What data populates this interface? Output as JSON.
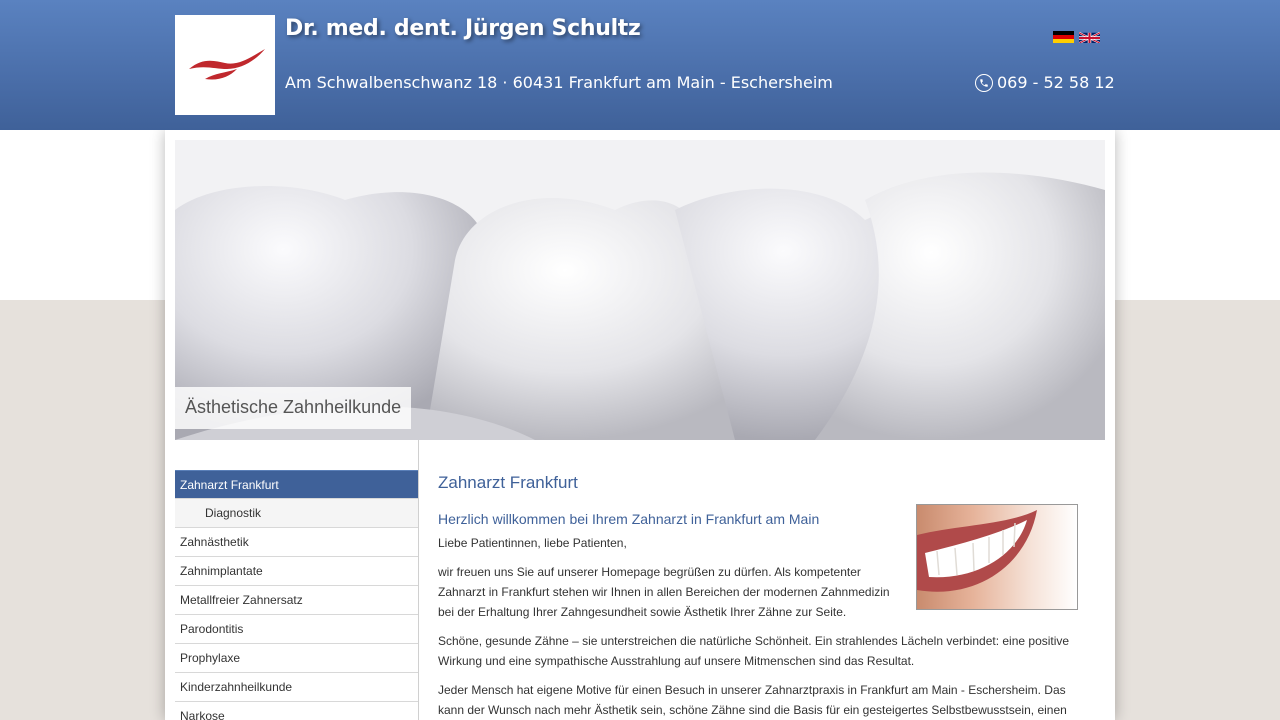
{
  "header": {
    "title": "Dr. med. dent. Jürgen Schultz",
    "address": "Am Schwalbenschwanz 18 · 60431 Frankfurt am Main - Eschersheim",
    "phone": "069 - 52 58 12",
    "languages": [
      "Deutsch",
      "English"
    ]
  },
  "hero": {
    "caption": "Ästhetische Zahnheilkunde"
  },
  "sidebar": {
    "items": [
      {
        "label": "Zahnarzt Frankfurt",
        "active": true
      },
      {
        "label": "Diagnostik",
        "sub": true
      },
      {
        "label": "Zahnästhetik"
      },
      {
        "label": "Zahnimplantate"
      },
      {
        "label": "Metallfreier Zahnersatz"
      },
      {
        "label": "Parodontitis"
      },
      {
        "label": "Prophylaxe"
      },
      {
        "label": "Kinderzahnheilkunde"
      },
      {
        "label": "Narkose"
      }
    ]
  },
  "content": {
    "heading": "Zahnarzt Frankfurt",
    "subheading": "Herzlich willkommen bei Ihrem Zahnarzt in Frankfurt am Main",
    "greeting": "Liebe Patientinnen, liebe Patienten,",
    "paragraph1": "wir freuen uns Sie auf unserer Homepage begrüßen zu dürfen. Als kompetenter Zahnarzt in Frankfurt stehen wir Ihnen in allen Bereichen der modernen Zahnmedizin bei der Erhaltung Ihrer Zahngesundheit sowie Ästhetik Ihrer Zähne zur Seite.",
    "paragraph2": "Schöne, gesunde Zähne – sie unterstreichen die natürliche Schönheit. Ein strahlendes Lächeln verbindet: eine positive Wirkung und eine sympathische Ausstrahlung auf unsere Mitmenschen sind das Resultat.",
    "paragraph3": "Jeder Mensch hat eigene Motive für einen Besuch in unserer Zahnarztpraxis in Frankfurt am Main - Eschersheim. Das kann der Wunsch nach mehr Ästhetik sein, schöne Zähne sind die Basis für ein gesteigertes Selbstbewusstsein, einen"
  },
  "colors": {
    "header_blue": "#4a6ea9",
    "accent": "#3f6199",
    "logo_red": "#c0282d"
  }
}
